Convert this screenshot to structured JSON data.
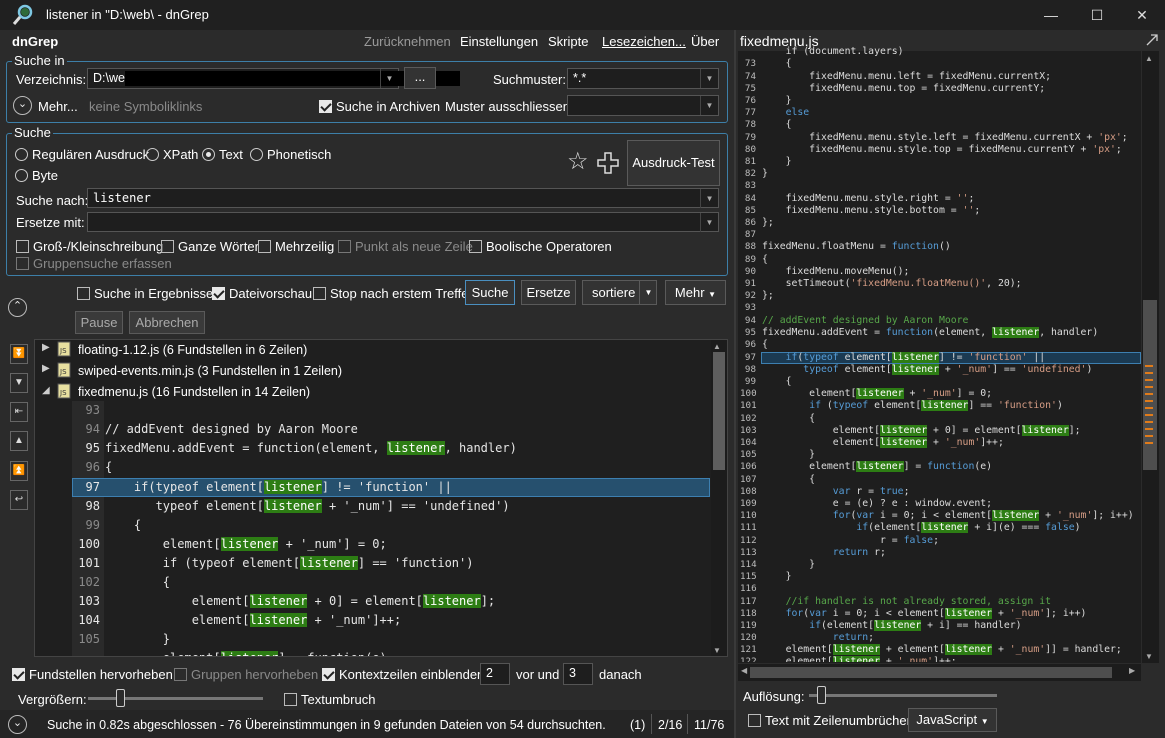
{
  "window": {
    "title": "listener in \"D:\\web\\ - dnGrep",
    "minimize": "—",
    "maximize": "☐",
    "close": "✕"
  },
  "app_name": "dnGrep",
  "menu": {
    "undo": "Zurücknehmen",
    "settings": "Einstellungen",
    "scripts": "Skripte",
    "bookmarks": "Lesezeichen...",
    "about": "Über"
  },
  "search_in": {
    "legend": "Suche in",
    "dir_label": "Verzeichnis:",
    "dir_value": "D:\\web",
    "browse": "...",
    "pattern_label": "Suchmuster:",
    "pattern_value": "*.*",
    "more_label": "Mehr...",
    "symlinks": "keine Symboliklinks",
    "archives_label": "Suche in Archiven",
    "exclude_label": "Muster ausschliessen:"
  },
  "search": {
    "legend": "Suche",
    "regex": "Regulären Ausdruck",
    "xpath": "XPath",
    "text": "Text",
    "phonetic": "Phonetisch",
    "byte": "Byte",
    "search_for_label": "Suche nach:",
    "search_for_value": "listener",
    "replace_label": "Ersetze mit:",
    "test_button": "Ausdruck-Test",
    "case": "Groß-/Kleinschreibung",
    "whole": "Ganze Wörter",
    "multiline": "Mehrzeilig",
    "dot_newline": "Punkt als neue Zeile",
    "boolean": "Boolische Operatoren",
    "group_search": "Gruppensuche erfassen"
  },
  "actions": {
    "in_results": "Suche in Ergebnissen",
    "preview": "Dateivorschau",
    "stop_first": "Stop nach erstem Treffer",
    "search": "Suche",
    "replace": "Ersetze",
    "sort": "sortiere",
    "more": "Mehr",
    "pause": "Pause",
    "cancel": "Abbrechen"
  },
  "results": {
    "files": [
      {
        "name": "floating-1.12.js (6 Fundstellen in 6 Zeilen)"
      },
      {
        "name": "swiped-events.min.js (3 Fundstellen in 1 Zeilen)"
      },
      {
        "name": "fixedmenu.js (16 Fundstellen in 14 Zeilen)"
      }
    ]
  },
  "bottom": {
    "highlight": "Fundstellen hervorheben",
    "group_highlight": "Gruppen hervorheben",
    "context": "Kontextzeilen einblenden",
    "before": "2",
    "before_label": "vor und",
    "after": "3",
    "after_label": "danach",
    "zoom_label": "Vergrößern:",
    "wrap": "Textumbruch",
    "status": "Suche in 0.82s abgeschlossen - 76 Übereinstimmungen in 9 gefunden Dateien von 54 durchsuchten.",
    "status_files": "(1)",
    "status_pos": "2/16",
    "status_count": "11/76"
  },
  "preview": {
    "title": "fixedmenu.js",
    "resolution_label": "Auflösung:",
    "wrap_label": "Text mit Zeilenumbrüchen",
    "language": "JavaScript"
  }
}
